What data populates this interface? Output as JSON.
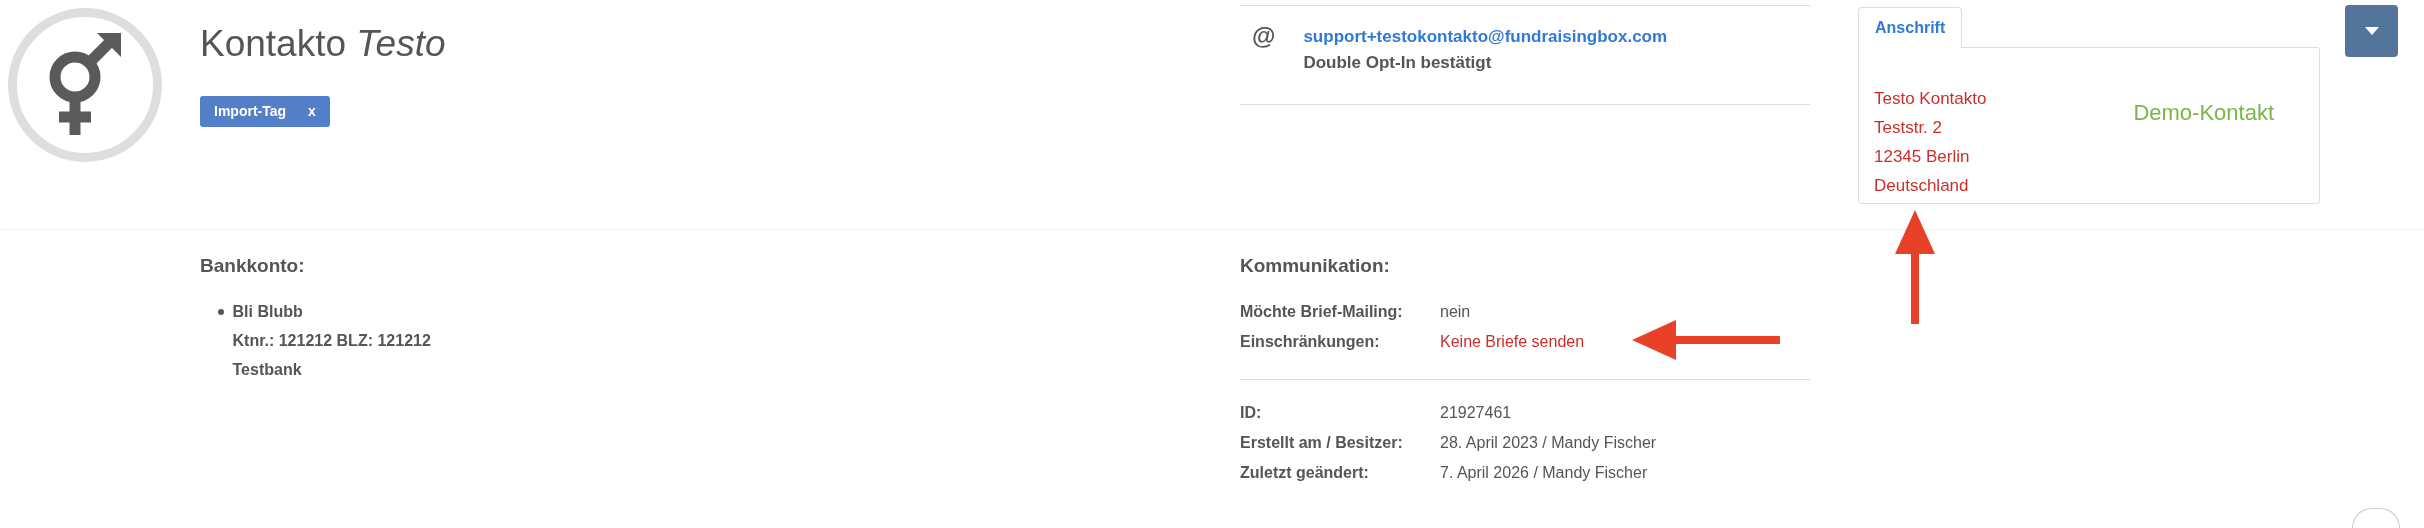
{
  "contact": {
    "first_name": "Kontakto",
    "last_name": "Testo"
  },
  "tags": [
    {
      "label": "Import-Tag",
      "remove": "x"
    }
  ],
  "email": {
    "symbol": "@",
    "address": "support+testokontakto@fundraisingbox.com",
    "status": "Double Opt-In bestätigt"
  },
  "address_tabs": [
    {
      "label": "Anschrift",
      "selected": true
    }
  ],
  "address": {
    "lines": [
      "Testo Kontakto",
      "Teststr. 2",
      "12345 Berlin",
      "Deutschland"
    ],
    "label": "Demo-Kontakt"
  },
  "bank_account": {
    "heading": "Bankkonto:",
    "items": [
      {
        "name": "Bli Blubb",
        "numbers": "Ktnr.: 121212 BLZ: 121212",
        "bank": "Testbank"
      }
    ]
  },
  "communication": {
    "heading": "Kommunikation:",
    "rows": [
      {
        "label": "Möchte Brief-Mailing:",
        "value": "nein",
        "kind": "normal"
      },
      {
        "label": "Einschränkungen:",
        "value": "Keine Briefe senden",
        "kind": "warning"
      }
    ]
  },
  "meta": [
    {
      "label": "ID:",
      "value": "21927461"
    },
    {
      "label": "Erstellt am / Besitzer:",
      "value": "28. April 2023 / Mandy Fischer"
    },
    {
      "label": "Zuletzt geändert:",
      "value": "7. April 2026 / Mandy Fischer"
    }
  ]
}
